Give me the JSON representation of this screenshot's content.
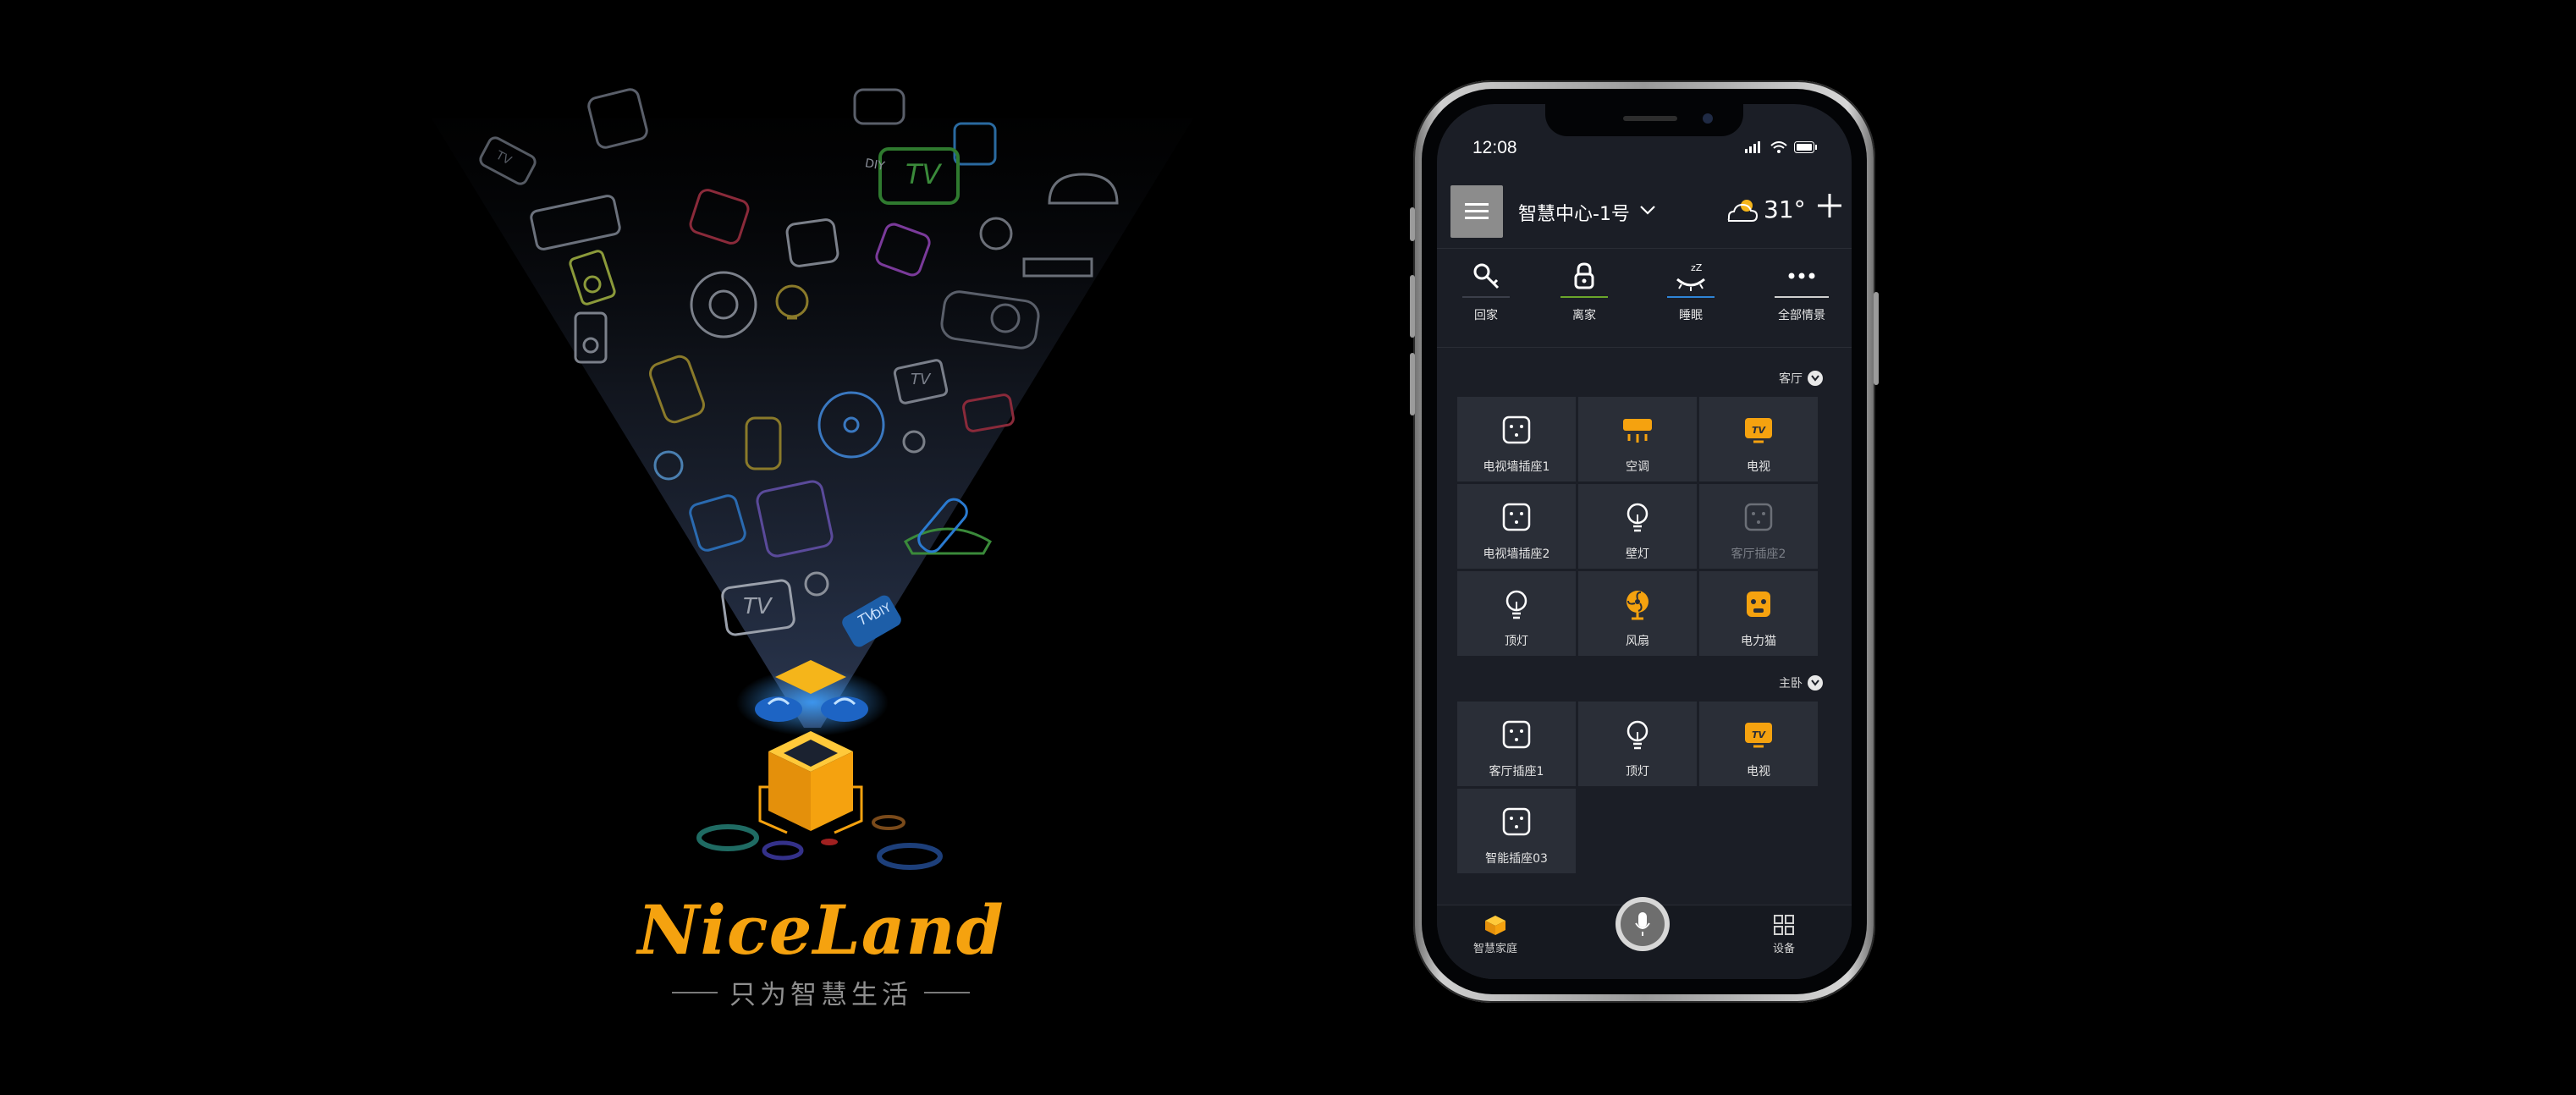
{
  "splash": {
    "brand": "NiceLand",
    "slogan": "只为智慧生活",
    "floating_icons": [
      {
        "name": "tv-icon",
        "label": "TV",
        "color": "#3a8a3a"
      },
      {
        "name": "tv-icon",
        "label": "TV",
        "color": "#7a7f8a"
      },
      {
        "name": "tv-icon",
        "label": "TV",
        "color": "#9aa0ab"
      },
      {
        "name": "tv-icon",
        "label": "TV",
        "color": "#2b7fd0"
      },
      {
        "name": "diy-module-icon",
        "label": "DIY",
        "color": "#8a8f99"
      },
      {
        "name": "diy-module-icon",
        "label": "DIY",
        "color": "#3a86d8"
      },
      {
        "name": "tv-icon",
        "label": "TV",
        "color": "#555a63"
      }
    ]
  },
  "status_bar": {
    "time": "12:08"
  },
  "header": {
    "hub_name": "智慧中心-1号",
    "temperature": "31°"
  },
  "scenes": [
    {
      "label": "回家",
      "icon": "key-icon",
      "bar_color": "#3b3f4a"
    },
    {
      "label": "离家",
      "icon": "lock-icon",
      "bar_color": "#6aa52a"
    },
    {
      "label": "睡眠",
      "icon": "sleep-icon",
      "bar_color": "#2e84d6"
    },
    {
      "label": "全部情景",
      "icon": "more-icon",
      "bar_color": "#cfcfcf"
    }
  ],
  "rooms": [
    {
      "name": "客厅",
      "devices": [
        {
          "label": "电视墙插座1",
          "icon": "socket-icon",
          "state": "on"
        },
        {
          "label": "空调",
          "icon": "air-conditioner-icon",
          "state": "on"
        },
        {
          "label": "电视",
          "icon": "tv-icon",
          "state": "on"
        },
        {
          "label": "电视墙插座2",
          "icon": "socket-icon",
          "state": "on"
        },
        {
          "label": "壁灯",
          "icon": "bulb-icon",
          "state": "on"
        },
        {
          "label": "客厅插座2",
          "icon": "socket-icon",
          "state": "off"
        },
        {
          "label": "顶灯",
          "icon": "bulb-icon",
          "state": "on"
        },
        {
          "label": "风扇",
          "icon": "fan-icon",
          "state": "on"
        },
        {
          "label": "电力猫",
          "icon": "powerline-icon",
          "state": "on"
        }
      ]
    },
    {
      "name": "主卧",
      "devices": [
        {
          "label": "客厅插座1",
          "icon": "socket-icon",
          "state": "on"
        },
        {
          "label": "顶灯",
          "icon": "bulb-icon",
          "state": "on"
        },
        {
          "label": "电视",
          "icon": "tv-icon",
          "state": "on"
        },
        {
          "label": "智能插座03",
          "icon": "socket-icon",
          "state": "on"
        }
      ]
    }
  ],
  "tabbar": {
    "home_label": "智慧家庭",
    "devices_label": "设备"
  },
  "colors": {
    "accent": "#f5a20f",
    "tile_bg": "#2a2e37",
    "screen_bg": "#1b1e26"
  }
}
